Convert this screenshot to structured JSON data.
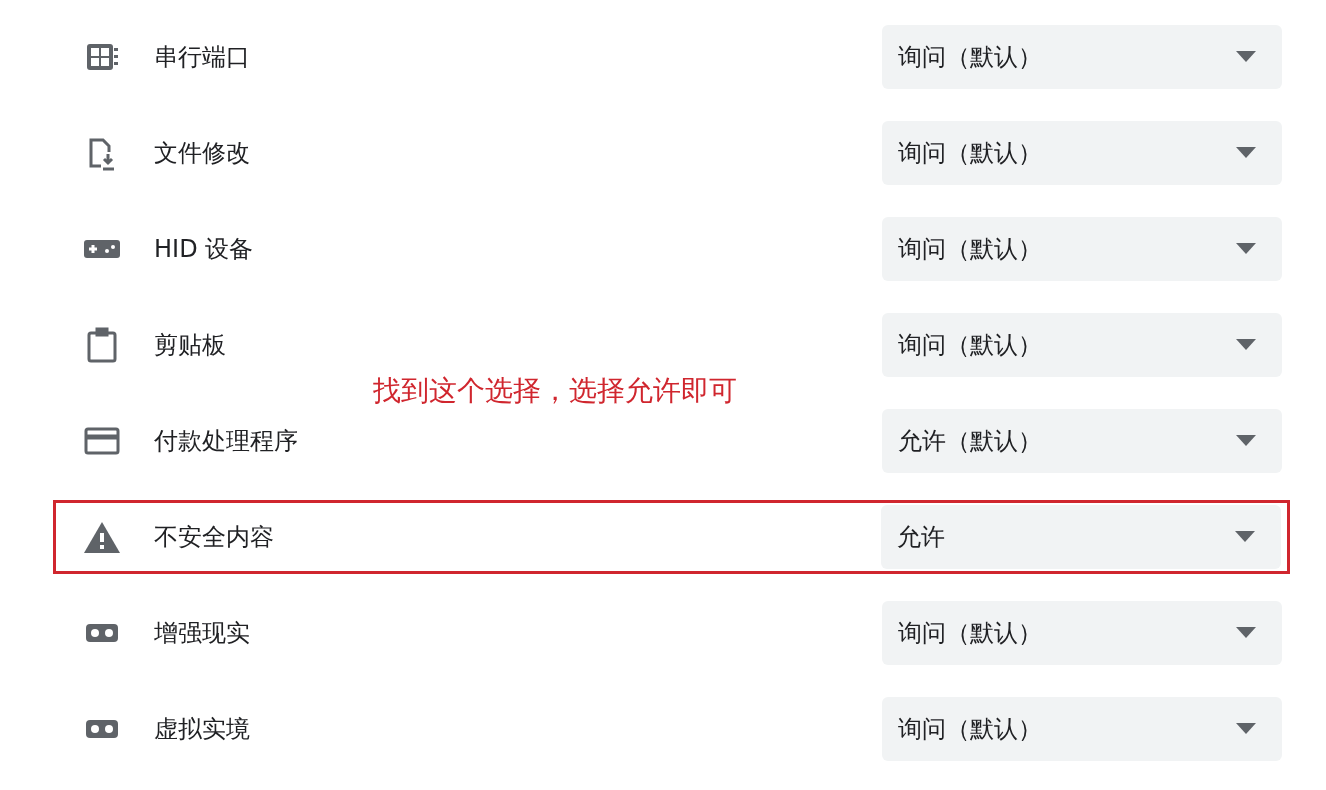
{
  "permissions": [
    {
      "label": "串行端口",
      "value": "询问（默认）",
      "highlighted": false
    },
    {
      "label": "文件修改",
      "value": "询问（默认）",
      "highlighted": false
    },
    {
      "label": "HID 设备",
      "value": "询问（默认）",
      "highlighted": false
    },
    {
      "label": "剪贴板",
      "value": "询问（默认）",
      "highlighted": false
    },
    {
      "label": "付款处理程序",
      "value": "允许（默认）",
      "highlighted": false
    },
    {
      "label": "不安全内容",
      "value": "允许",
      "highlighted": true
    },
    {
      "label": "增强现实",
      "value": "询问（默认）",
      "highlighted": false
    },
    {
      "label": "虚拟实境",
      "value": "询问（默认）",
      "highlighted": false
    }
  ],
  "annotation": "找到这个选择，选择允许即可"
}
